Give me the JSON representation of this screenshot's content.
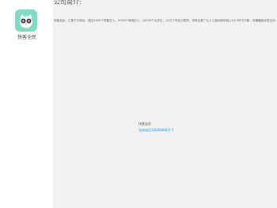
{
  "sidebar": {
    "app_icon": "owl-icon",
    "app_name": "快客全民"
  },
  "main": {
    "title": "公司简介:",
    "description": "快客全民，汇集千万粉丝，超过1000个明星艺人，5000个网络红人，10000个大学生，10万个市民代表的，将商业推广从人工面对面到线上24小时不中断，传播最新优惠互动。",
    "company_name": "快客全民",
    "contact": "咨询电话18888888号 ll"
  },
  "colors": {
    "logo_bg": "#7ddcc3",
    "main_bg": "#f1f1f1",
    "link": "#2a9ee0"
  }
}
